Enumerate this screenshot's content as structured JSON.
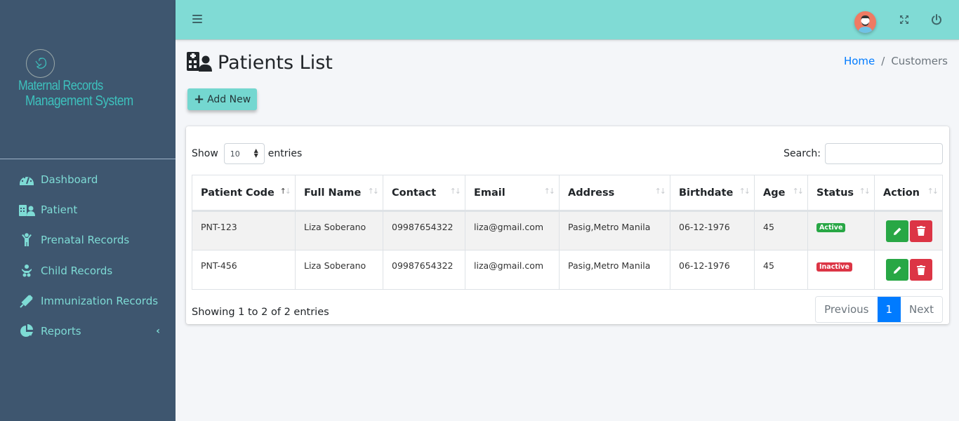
{
  "brand": {
    "line1": "Maternal Records",
    "line2": "Management System",
    "logo_icon": "fetus-icon"
  },
  "sidebar": {
    "items": [
      {
        "label": "Dashboard",
        "icon": "tachometer-icon"
      },
      {
        "label": "Patient",
        "icon": "hospital-user-icon"
      },
      {
        "label": "Prenatal Records",
        "icon": "child-icon"
      },
      {
        "label": "Child Records",
        "icon": "baby-icon"
      },
      {
        "label": "Immunization Records",
        "icon": "syringe-icon"
      },
      {
        "label": "Reports",
        "icon": "chart-pie-icon",
        "chevron": "‹"
      }
    ]
  },
  "topbar": {
    "menu_icon": "hamburger-icon",
    "avatar_icon": "user-avatar",
    "fullscreen_icon": "expand-arrows-icon",
    "power_icon": "power-off-icon"
  },
  "page": {
    "title": "Patients List",
    "title_icon": "hospital-user-icon",
    "breadcrumb": {
      "home": "Home",
      "separator": "/",
      "current": "Customers"
    },
    "add_button": {
      "plus": "+",
      "label": "Add New"
    }
  },
  "table_controls": {
    "show_label": "Show",
    "entries_value": "10",
    "entries_label": "entries",
    "search_label": "Search:",
    "search_value": ""
  },
  "table": {
    "columns": [
      "Patient Code",
      "Full Name",
      "Contact",
      "Email",
      "Address",
      "Birthdate",
      "Age",
      "Status",
      "Action"
    ],
    "sorted_column": "Patient Code",
    "rows": [
      {
        "code": "PNT-123",
        "name": "Liza Soberano",
        "contact": "09987654322",
        "email": "liza@gmail.com",
        "address": "Pasig,Metro Manila",
        "birthdate": "06-12-1976",
        "age": "45",
        "status": "Active"
      },
      {
        "code": "PNT-456",
        "name": "Liza Soberano",
        "contact": "09987654322",
        "email": "liza@gmail.com",
        "address": "Pasig,Metro Manila",
        "birthdate": "06-12-1976",
        "age": "45",
        "status": "Inactive"
      }
    ],
    "sort_glyphs": {
      "up": "↑",
      "down": "↓"
    }
  },
  "footer": {
    "info": "Showing 1 to 2 of 2 entries",
    "pagination": {
      "previous": "Previous",
      "current": "1",
      "next": "Next"
    }
  },
  "colors": {
    "sidebar_bg": "#3e566f",
    "topbar_bg": "#80dbd5",
    "accent_teal": "#74d7d0",
    "active_green": "#28a745",
    "inactive_red": "#dc3545",
    "page_primary": "#007bff"
  }
}
